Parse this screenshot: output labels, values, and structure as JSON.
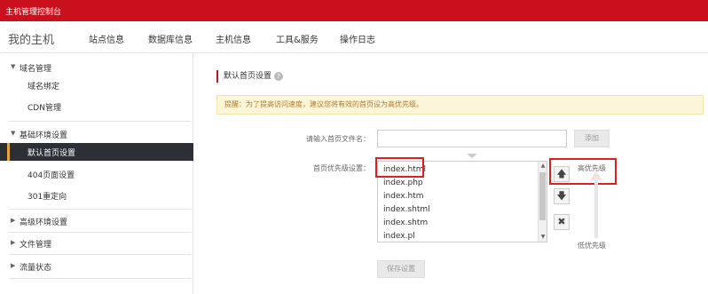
{
  "topbar": {
    "title": "主机管理控制台"
  },
  "nav": {
    "home": "我的主机",
    "items": [
      "站点信息",
      "数据库信息",
      "主机信息",
      "工具&服务",
      "操作日志"
    ]
  },
  "sidebar": {
    "groups": [
      {
        "label": "域名管理",
        "expanded": true,
        "items": [
          "域名绑定",
          "CDN管理"
        ]
      },
      {
        "label": "基础环境设置",
        "expanded": true,
        "items": [
          "默认首页设置",
          "404页面设置",
          "301重定向"
        ]
      },
      {
        "label": "高级环境设置",
        "expanded": false,
        "items": []
      },
      {
        "label": "文件管理",
        "expanded": false,
        "items": []
      },
      {
        "label": "流量状态",
        "expanded": false,
        "items": []
      }
    ],
    "active_item": "默认首页设置",
    "expanded_arrow": "▼",
    "collapsed_arrow": "▶"
  },
  "main": {
    "title": "默认首页设置",
    "help_glyph": "?",
    "notice": "提醒：为了提高访问速度，建议您将有效的首页设为高优先级。",
    "filename_label": "请输入首页文件名：",
    "filename_value": "",
    "add_button": "添加",
    "priority_label": "首页优先级设置：",
    "index_files": [
      "index.html",
      "index.php",
      "index.htm",
      "index.shtml",
      "index.shtm",
      "index.pl"
    ],
    "move_up_glyph": "🡅",
    "move_down_glyph": "🡇",
    "delete_glyph": "✖",
    "high_priority": "高优先级",
    "low_priority": "低优先级",
    "save_button": "保存设置"
  },
  "colors": {
    "brand": "#c9101c",
    "active_bg": "#2b2f36",
    "active_accent": "#e8a33a",
    "notice_bg": "#fdf5d9",
    "highlight": "#e02020"
  }
}
